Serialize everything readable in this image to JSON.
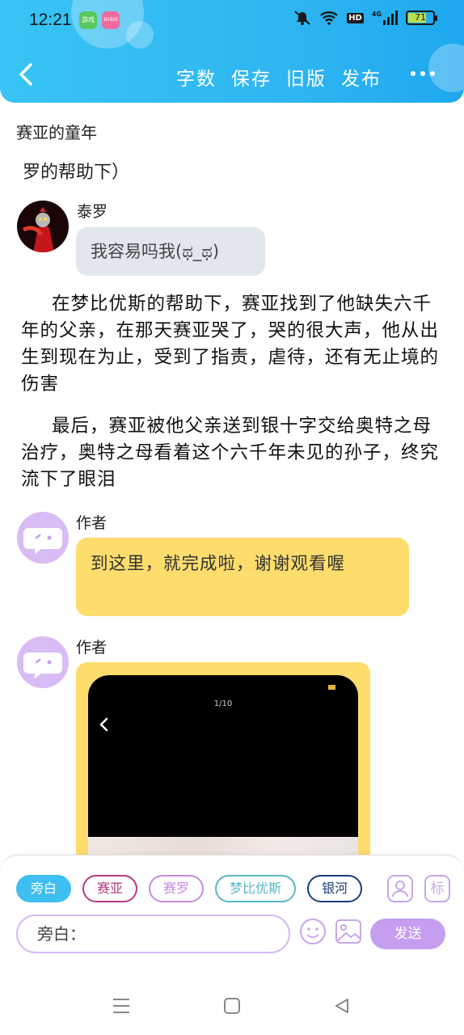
{
  "status_bar": {
    "time": "12:21",
    "hd_label": "HD",
    "signal_label": "4G",
    "battery": "71",
    "app_icon_1": "游戏",
    "app_icon_2": "bilibili"
  },
  "nav": {
    "actions": [
      "字数",
      "保存",
      "旧版",
      "发布"
    ]
  },
  "content": {
    "doc_title": "赛亚的童年",
    "line_partial": "罗的帮助下）",
    "msg1": {
      "speaker": "泰罗",
      "text": "我容易吗我(ಥ_ಥ)"
    },
    "para1": "在梦比优斯的帮助下，赛亚找到了他缺失六千年的父亲，在那天赛亚哭了，哭的很大声，他从出生到现在为止，受到了指责，虐待，还有无止境的伤害",
    "para2": "最后，赛亚被他父亲送到银十字交给奥特之母治疗，奥特之母看着这个六千年未见的孙子，终究流下了眼泪",
    "msg2": {
      "speaker": "作者",
      "text": "到这里，就完成啦，谢谢观看喔"
    },
    "msg3": {
      "speaker": "作者",
      "image_counter": "1/10"
    }
  },
  "composer": {
    "chips": [
      {
        "label": "旁白",
        "color": "#3fbef2",
        "filled": true
      },
      {
        "label": "赛亚",
        "color": "#b43a7e",
        "filled": false
      },
      {
        "label": "赛罗",
        "color": "#c58be0",
        "filled": false
      },
      {
        "label": "梦比优斯",
        "color": "#5bb6c6",
        "filled": false
      },
      {
        "label": "银河",
        "color": "#1b3e7a",
        "filled": false
      }
    ],
    "tool_label": "标",
    "input_value": "旁白：",
    "send_label": "发送"
  },
  "colors": {
    "header": "#2fb6f2",
    "yellow_bubble": "#fedd6d",
    "grey_bubble": "#e2e6ee",
    "accent_purple": "#c59ef0"
  }
}
